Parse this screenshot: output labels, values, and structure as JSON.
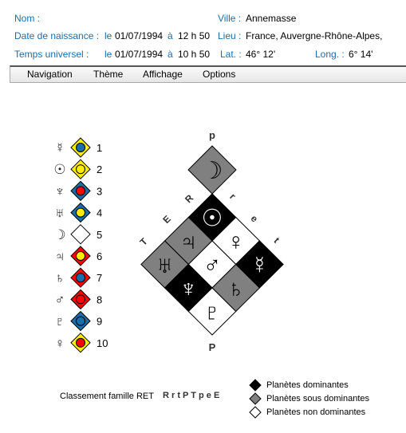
{
  "header": {
    "nom_label": "Nom :",
    "ville_label": "Ville :",
    "ville": "Annemasse",
    "naissance_label": "Date de naissance :",
    "naissance_le": "le",
    "naissance_date": "01/07/1994",
    "naissance_a": "à",
    "naissance_heure": "12 h 50",
    "lieu_label": "Lieu :",
    "lieu": "France, Auvergne-Rhône-Alpes,",
    "tu_label": "Temps universel :",
    "tu_le": "le",
    "tu_date": "01/07/1994",
    "tu_a": "à",
    "tu_heure": "10 h 50",
    "lat_label": "Lat. :",
    "lat": "46° 12'",
    "long_label": "Long. :",
    "long": "6° 14'"
  },
  "menu": [
    "Navigation",
    "Thème",
    "Affichage",
    "Options"
  ],
  "ranking": [
    {
      "rank": "1",
      "glyph": "☿",
      "planet": "Mercure",
      "outer": "#ffee00",
      "inner": "#1a6ea8"
    },
    {
      "rank": "2",
      "glyph": "☉",
      "planet": "Soleil",
      "outer": "#ffee00",
      "inner": "#ffee00"
    },
    {
      "rank": "3",
      "glyph": "♆",
      "planet": "Neptune",
      "outer": "#1a6ea8",
      "inner": "#ff0000"
    },
    {
      "rank": "4",
      "glyph": "♅",
      "planet": "Uranus",
      "outer": "#1a6ea8",
      "inner": "#ffee00"
    },
    {
      "rank": "5",
      "glyph": "☽",
      "planet": "Lune",
      "outer": "#ffffff",
      "inner": ""
    },
    {
      "rank": "6",
      "glyph": "♃",
      "planet": "Jupiter",
      "outer": "#ff0000",
      "inner": "#ffee00"
    },
    {
      "rank": "7",
      "glyph": "♄",
      "planet": "Saturne",
      "outer": "#ff0000",
      "inner": "#1a6ea8"
    },
    {
      "rank": "8",
      "glyph": "♂",
      "planet": "Mars",
      "outer": "#ff0000",
      "inner": "#ff0000"
    },
    {
      "rank": "9",
      "glyph": "♇",
      "planet": "Pluton",
      "outer": "#1a6ea8",
      "inner": "#1a6ea8"
    },
    {
      "rank": "10",
      "glyph": "♀",
      "planet": "Vénus",
      "outer": "#ffee00",
      "inner": "#ff0000"
    }
  ],
  "diagram": {
    "top_label": "p",
    "bottom_label": "P",
    "left_edge": [
      "T",
      "E",
      "R"
    ],
    "right_edge": [
      "r",
      "e",
      "t"
    ],
    "moon": {
      "glyph": "☽",
      "fill": "#808080",
      "ink": "#000"
    },
    "cells": [
      {
        "i": 0,
        "j": 0,
        "glyph": "☉",
        "fill": "#000000",
        "ink": "#fff"
      },
      {
        "i": 0,
        "j": 1,
        "glyph": "♃",
        "fill": "#808080",
        "ink": "#000"
      },
      {
        "i": 0,
        "j": 2,
        "glyph": "♅",
        "fill": "#808080",
        "ink": "#000"
      },
      {
        "i": 1,
        "j": 0,
        "glyph": "♀",
        "fill": "#ffffff",
        "ink": "#000"
      },
      {
        "i": 1,
        "j": 1,
        "glyph": "♂",
        "fill": "#ffffff",
        "ink": "#000"
      },
      {
        "i": 1,
        "j": 2,
        "glyph": "♆",
        "fill": "#000000",
        "ink": "#fff"
      },
      {
        "i": 2,
        "j": 0,
        "glyph": "☿",
        "fill": "#000000",
        "ink": "#fff"
      },
      {
        "i": 2,
        "j": 1,
        "glyph": "♄",
        "fill": "#808080",
        "ink": "#000"
      },
      {
        "i": 2,
        "j": 2,
        "glyph": "♇",
        "fill": "#ffffff",
        "ink": "#000"
      }
    ]
  },
  "footer": {
    "classement_label": "Classement famille RET",
    "classement": "R r t P T p e E"
  },
  "legend": [
    {
      "label": "Planètes dominantes",
      "fill": "#000000"
    },
    {
      "label": "Planètes sous dominantes",
      "fill": "#808080"
    },
    {
      "label": "Planètes non dominantes",
      "fill": "#ffffff"
    }
  ]
}
